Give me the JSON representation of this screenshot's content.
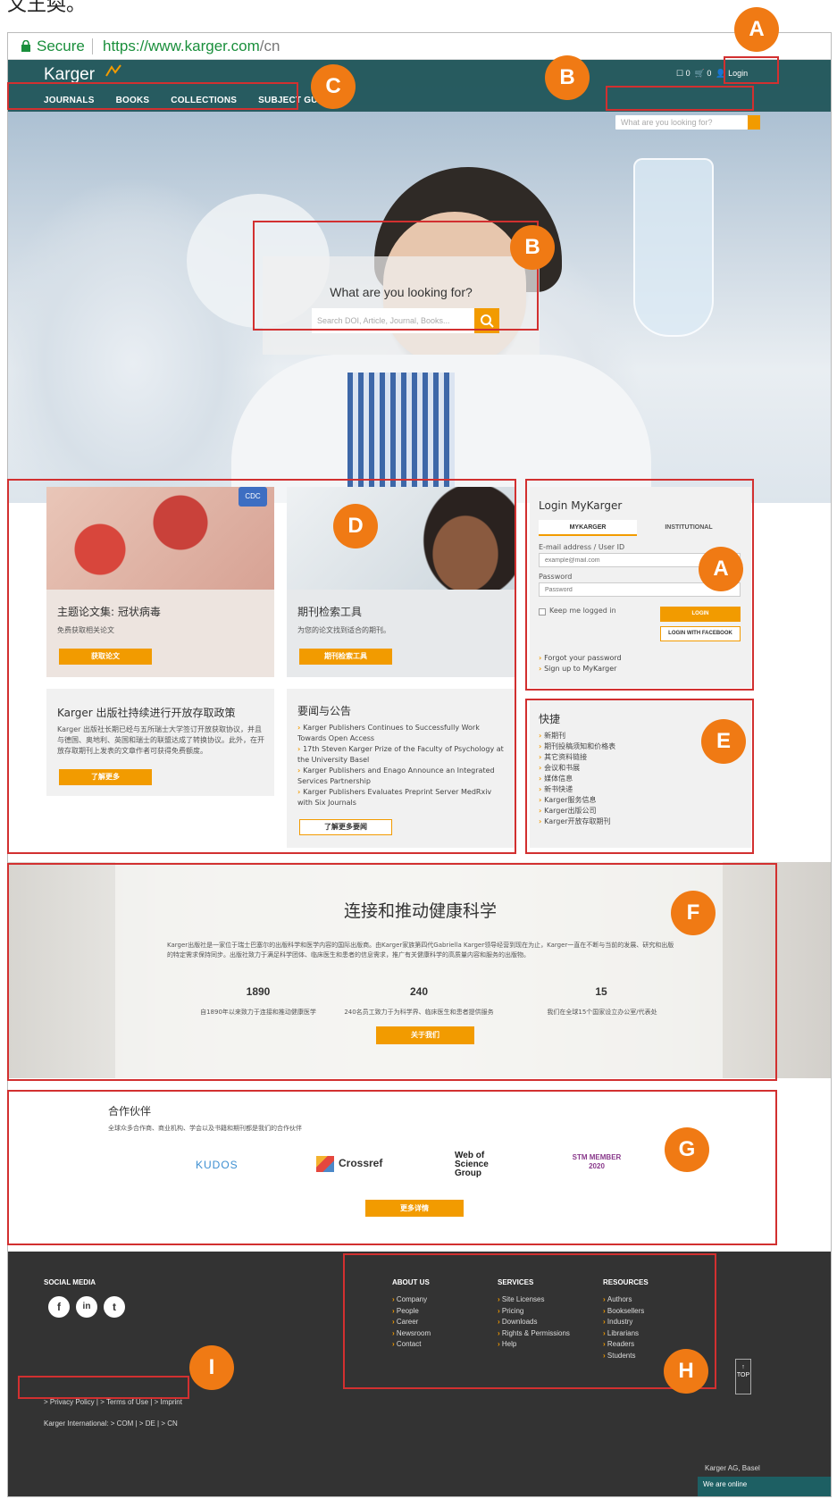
{
  "snippet_text": "文王奐。",
  "browser": {
    "secure_label": "Secure",
    "url_host": "https://www.karger.com",
    "url_path": "/cn"
  },
  "header": {
    "logo": "Karger",
    "nav": [
      "JOURNALS",
      "BOOKS",
      "COLLECTIONS",
      "SUBJECT GUIDE"
    ],
    "bookmarks_count": "0",
    "cart_count": "0",
    "login_label": "Login",
    "search_placeholder": "What are you looking for?"
  },
  "hero": {
    "question": "What are you looking for?",
    "search_placeholder": "Search DOI, Article, Journal, Books..."
  },
  "annotations": {
    "A": "A",
    "B": "B",
    "C": "C",
    "D": "D",
    "E": "E",
    "F": "F",
    "G": "G",
    "H": "H",
    "I": "I"
  },
  "cards": {
    "covid": {
      "title": "主题论文集: 冠状病毒",
      "text": "免费获取相关论文",
      "button": "获取论文",
      "badge": "CDC"
    },
    "tools": {
      "title": "期刊检索工具",
      "text": "为您的论文找到适合的期刊。",
      "button": "期刊检索工具"
    },
    "oa": {
      "title": "Karger 出版社持续进行开放存取政策",
      "text": "Karger 出版社长期已经与五所瑞士大学签订开放获取协议，并且与德国、奥地利、英国和瑞士的联盟达成了转换协议。此外，在开放存取期刊上发表的文章作者可获得免费额度。",
      "button": "了解更多"
    },
    "news": {
      "title": "要闻与公告",
      "items": [
        "Karger Publishers Continues to Successfully Work Towards Open Access",
        "17th Steven Karger Prize of the Faculty of Psychology at the University Basel",
        "Karger Publishers and Enago Announce an Integrated Services Partnership",
        "Karger Publishers Evaluates Preprint Server MedRxiv with Six Journals"
      ],
      "button": "了解更多要闻"
    }
  },
  "login": {
    "title": "Login MyKarger",
    "tabs": [
      "MYKARGER",
      "INSTITUTIONAL"
    ],
    "email_label": "E-mail address / User ID",
    "email_placeholder": "example@mail.com",
    "password_label": "Password",
    "password_placeholder": "Password",
    "keep_logged": "Keep me logged in",
    "login_button": "LOGIN",
    "facebook_button": "LOGIN WITH FACEBOOK",
    "links": [
      "Forgot your password",
      "Sign up to MyKarger"
    ]
  },
  "quick": {
    "title": "快捷",
    "items": [
      "新期刊",
      "期刊投稿须知和价格表",
      "其它资料链接",
      "会议和书展",
      "媒体信息",
      "新书快递",
      "Karger服务信息",
      "Karger出版公司",
      "Karger开放存取期刊"
    ]
  },
  "about": {
    "title": "连接和推动健康科学",
    "text": "Karger出版社是一家位于瑞士巴塞尔的出版科学和医学内容的国际出版商。由Karger家族第四代Gabriella Karger领导经营到现在为止，Karger一直在不断与当前的发展、研究和出版的特定需求保持同步。出版社致力于满足科学团体、临床医生和患者的信息需求，推广有关健康科学的高质量内容和服务的出版物。",
    "stats": [
      {
        "num": "1890",
        "label": "自1890年以来致力于连接和推动健康医学"
      },
      {
        "num": "240",
        "label": "240名员工致力于为科学界、临床医生和患者提供服务"
      },
      {
        "num": "15",
        "label": "我们在全球15个国家设立办公室/代表处"
      }
    ],
    "button": "关于我们"
  },
  "partners": {
    "title": "合作伙伴",
    "subtitle": "全球众多合作商、商业机构、学会以及书籍和期刊都是我们的合作伙伴",
    "logos": [
      "KUDOS",
      "Crossref",
      "Web of Science Group",
      "STM MEMBER 2020"
    ],
    "button": "更多详情"
  },
  "footer": {
    "social_title": "SOCIAL MEDIA",
    "social": [
      "f",
      "in",
      "t"
    ],
    "columns": [
      {
        "title": "ABOUT US",
        "items": [
          "Company",
          "People",
          "Career",
          "Newsroom",
          "Contact"
        ]
      },
      {
        "title": "SERVICES",
        "items": [
          "Site Licenses",
          "Pricing",
          "Downloads",
          "Rights & Permissions",
          "Help"
        ]
      },
      {
        "title": "RESOURCES",
        "items": [
          "Authors",
          "Booksellers",
          "Industry",
          "Librarians",
          "Readers",
          "Students"
        ]
      }
    ],
    "legal": "> Privacy Policy | > Terms of Use | > Imprint",
    "international": "Karger International: > COM | > DE | > CN",
    "top_label": "TOP",
    "company": "Karger AG, Basel",
    "chat": "We are online"
  }
}
